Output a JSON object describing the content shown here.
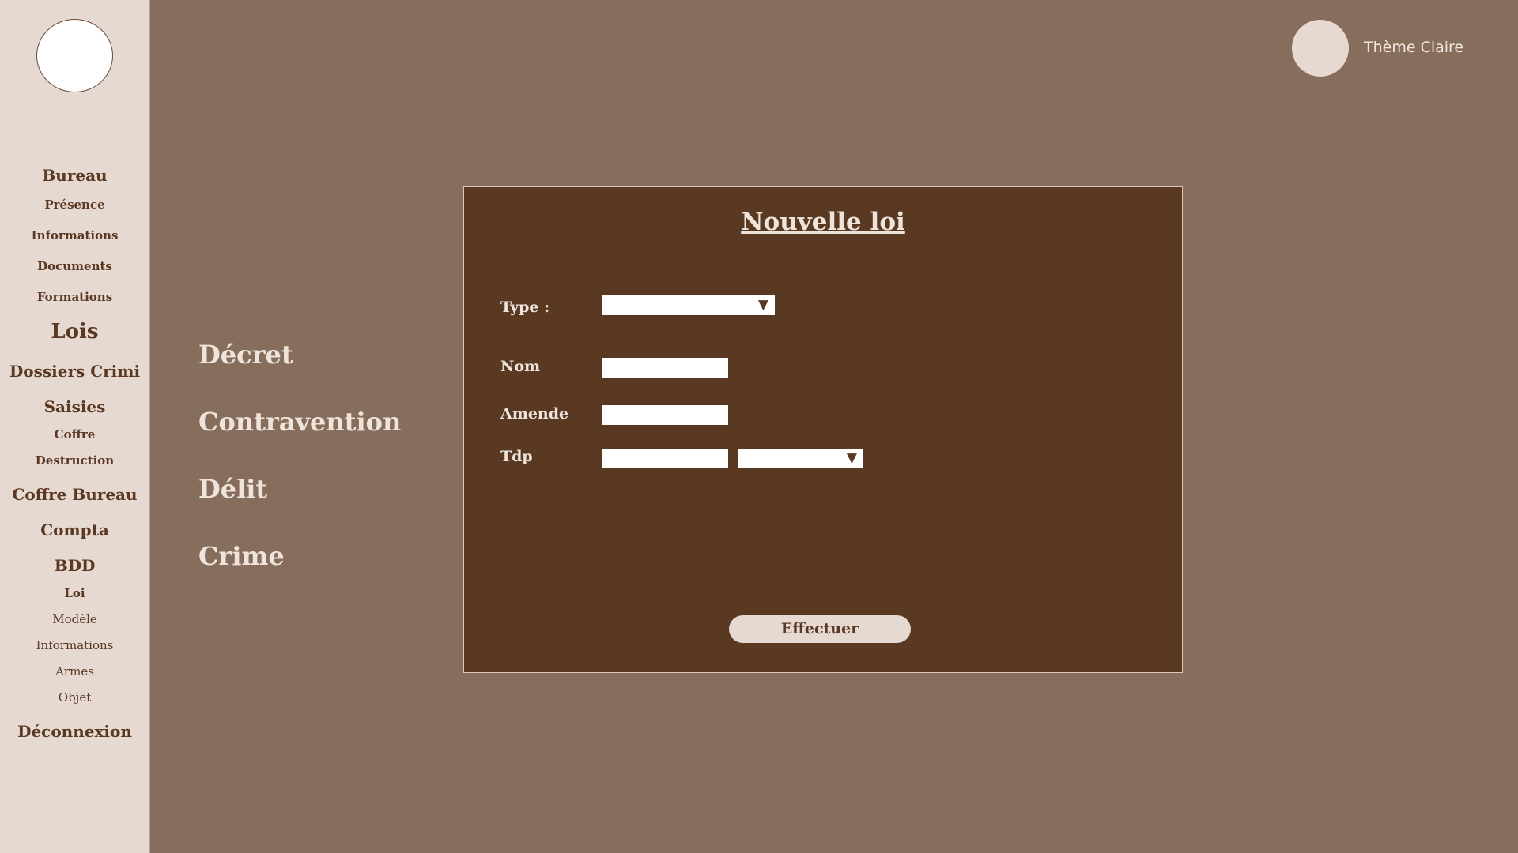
{
  "sidebar": {
    "items": [
      {
        "label": "Bureau"
      },
      {
        "label": "Présence"
      },
      {
        "label": "Informations"
      },
      {
        "label": "Documents"
      },
      {
        "label": "Formations"
      },
      {
        "label": "Lois"
      },
      {
        "label": "Dossiers Crimi"
      },
      {
        "label": "Saisies"
      },
      {
        "label": "Coffre"
      },
      {
        "label": "Destruction"
      },
      {
        "label": "Coffre Bureau"
      },
      {
        "label": "Compta"
      },
      {
        "label": "BDD"
      },
      {
        "label": "Loi"
      },
      {
        "label": "Modèle"
      },
      {
        "label": "Informations"
      },
      {
        "label": "Armes"
      },
      {
        "label": "Objet"
      },
      {
        "label": "Déconnexion"
      }
    ]
  },
  "header": {
    "theme_label": "Thème Claire"
  },
  "categories": [
    {
      "label": "Décret"
    },
    {
      "label": "Contravention"
    },
    {
      "label": "Délit"
    },
    {
      "label": "Crime"
    }
  ],
  "form": {
    "title": "Nouvelle loi",
    "type_label": "Type :",
    "type_value": "",
    "nom_label": "Nom",
    "nom_value": "",
    "amende_label": "Amende",
    "amende_value": "",
    "tdp_label": "Tdp",
    "tdp_value": "",
    "tdp_unit_value": "",
    "submit_label": "Effectuer"
  },
  "colors": {
    "sidebar_bg": "#e6d9d1",
    "page_bg": "#876d5c",
    "panel_bg": "#5a3923",
    "text_dark": "#5a3822",
    "text_light": "#efe4dc"
  },
  "icons": {
    "dropdown": "triangle-down-icon"
  }
}
